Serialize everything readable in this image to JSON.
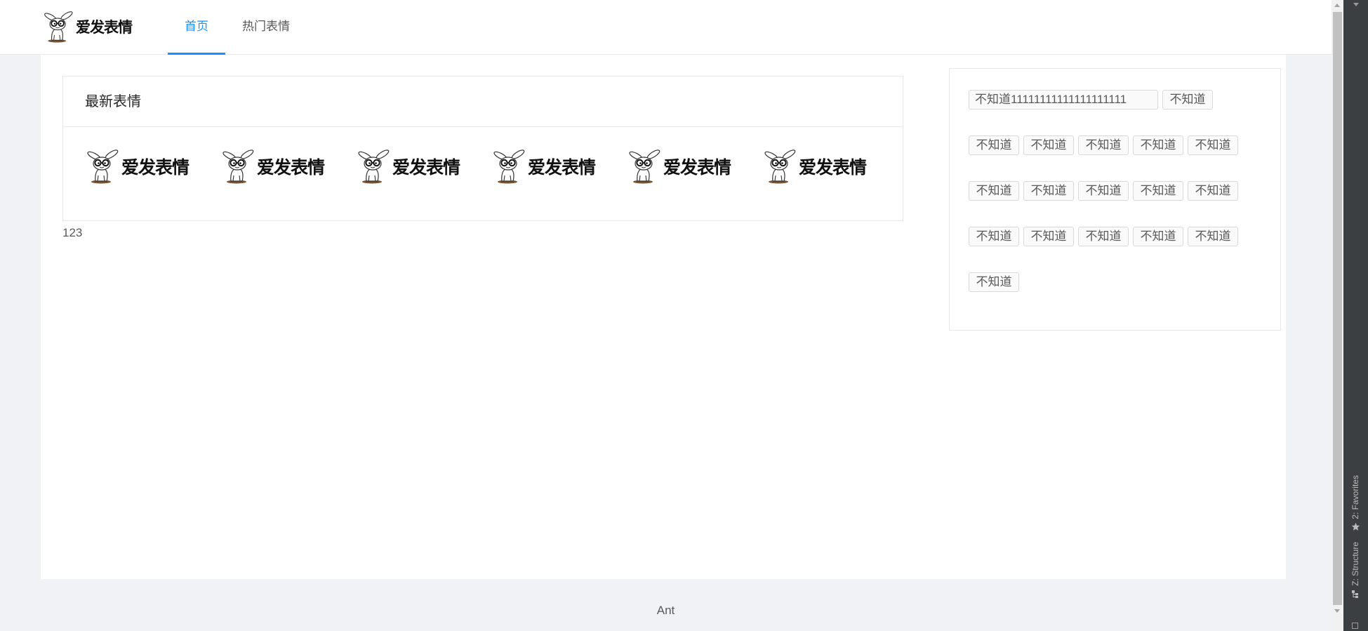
{
  "header": {
    "logo_text": "爱发表情",
    "nav": [
      {
        "label": "首页",
        "active": true
      },
      {
        "label": "热门表情",
        "active": false
      }
    ]
  },
  "latest": {
    "title": "最新表情",
    "items": [
      {
        "caption": "爱发表情"
      },
      {
        "caption": "爱发表情"
      },
      {
        "caption": "爱发表情"
      },
      {
        "caption": "爱发表情"
      },
      {
        "caption": "爱发表情"
      },
      {
        "caption": "爱发表情"
      }
    ]
  },
  "below_card_text": "123",
  "tags": [
    "不知道11111111111111111111",
    "不知道",
    "不知道",
    "不知道",
    "不知道",
    "不知道",
    "不知道",
    "不知道",
    "不知道",
    "不知道",
    "不知道",
    "不知道",
    "不知道",
    "不知道",
    "不知道",
    "不知道",
    "不知道",
    "不知道"
  ],
  "footer": {
    "text": "Ant"
  },
  "ide_panel": {
    "favorites_label": "2: Favorites",
    "structure_label": "Z: Structure"
  },
  "icons": {
    "logo": "rabbit-with-glasses-icon",
    "favorites": "star-icon",
    "structure": "structure-icon"
  },
  "colors": {
    "accent": "#1890ff",
    "page_background": "#f0f2f5",
    "ide_panel": "#3c3f41"
  }
}
